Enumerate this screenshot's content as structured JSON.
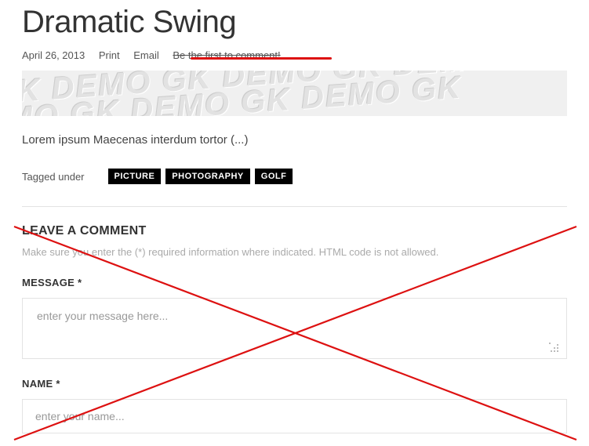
{
  "article": {
    "title": "Dramatic Swing",
    "date": "April 26, 2013",
    "print_label": "Print",
    "email_label": "Email",
    "comment_link": "Be the first to comment!",
    "banner_pattern": "GK DEMO  GK DEMO  GK DEMO  GK",
    "banner_pattern2": "DEMO  GK DEMO  GK DEMO  GK",
    "excerpt": "Lorem ipsum Maecenas interdum tortor (...)",
    "tagged_label": "Tagged under",
    "tags": [
      "PICTURE",
      "PHOTOGRAPHY",
      "GOLF"
    ]
  },
  "comment_form": {
    "heading": "LEAVE A COMMENT",
    "instructions": "Make sure you enter the (*) required information where indicated. HTML code is not allowed.",
    "message_label": "MESSAGE *",
    "message_placeholder": "enter your message here...",
    "name_label": "NAME *",
    "name_placeholder": "enter your name..."
  },
  "annotation": {
    "strike_color": "#d11"
  }
}
